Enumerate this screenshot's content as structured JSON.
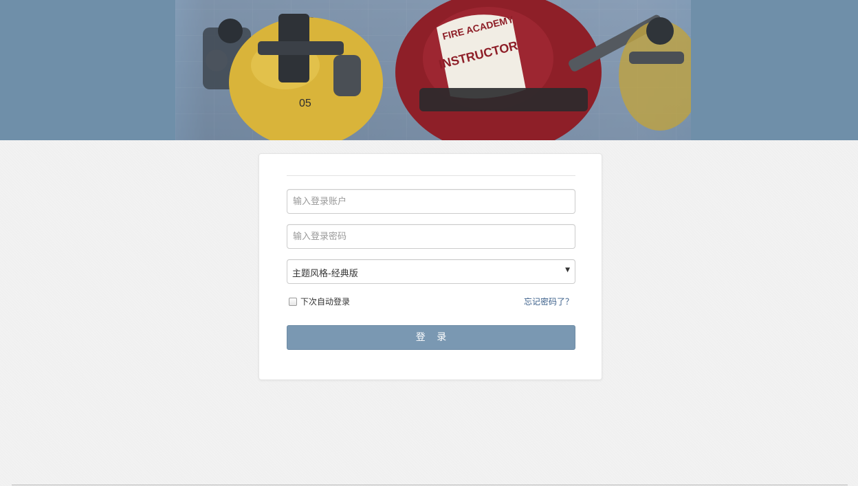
{
  "banner": {
    "helmet_text_top": "FIRE ACADEMY",
    "helmet_text_bottom": "INSTRUCTOR",
    "tank_marking": "05",
    "colors": {
      "banner_bg": "#6f8fa9",
      "helmet_red": "#8e1f28",
      "tank_yellow": "#d9b43a"
    }
  },
  "login": {
    "account_placeholder": "输入登录账户",
    "password_placeholder": "输入登录密码",
    "theme_select_value": "主题风格-经典版",
    "remember_label": "下次自动登录",
    "forgot_link": "忘记密码了？",
    "submit_label": "登 录",
    "remember_checked": false
  },
  "colors": {
    "accent": "#7a98b2",
    "link": "#3a5f8a"
  }
}
